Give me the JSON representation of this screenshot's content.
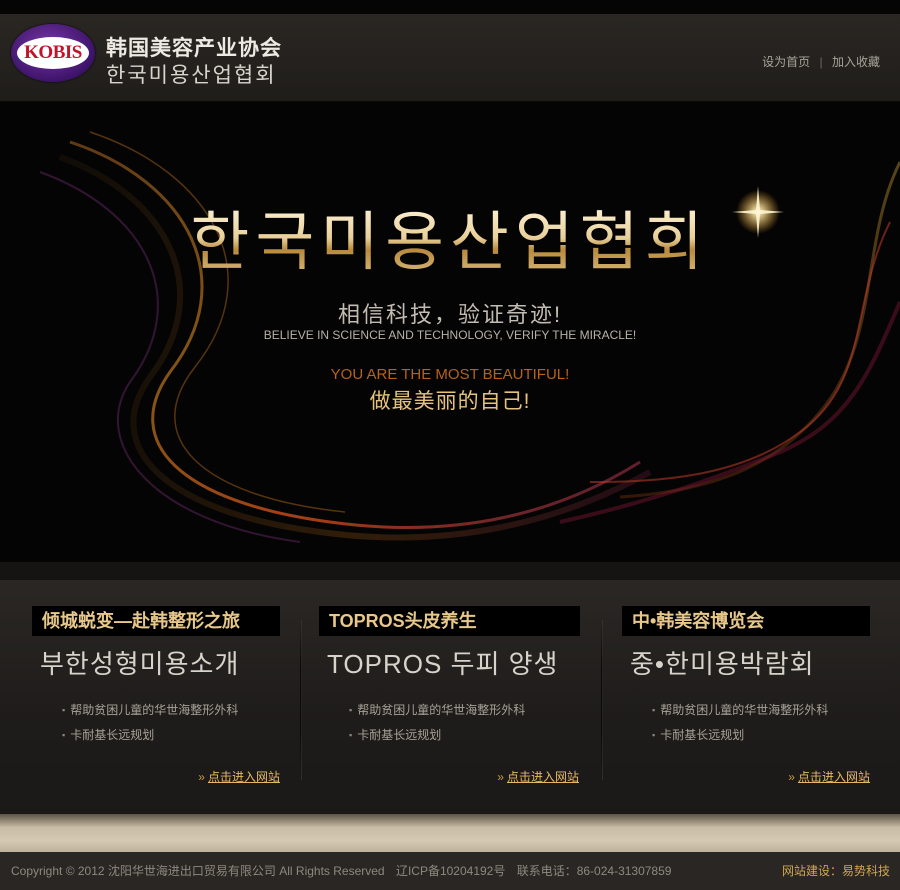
{
  "header": {
    "logo_text": "KOBIS",
    "org_name_cn": "韩国美容产业协会",
    "org_name_kr": "한국미용산업협회",
    "links": [
      "设为首页",
      "加入收藏"
    ],
    "link_separator": "|"
  },
  "hero": {
    "title_kr": "한국미용산업협회",
    "slogan_cn": "相信科技，验证奇迹!",
    "slogan_en": "BELIEVE IN SCIENCE AND TECHNOLOGY, VERIFY THE MIRACLE!",
    "tag_en": "YOU ARE THE MOST BEAUTIFUL!",
    "tag_cn": "做最美丽的自己!"
  },
  "features": [
    {
      "title": "倾城蜕变—赴韩整形之旅",
      "subtitle": "부한성형미용소개",
      "items": [
        "帮助贫困儿童的华世海整形外科",
        "卡耐基长远规划"
      ],
      "link_arrows": "»",
      "link_label": "点击进入网站"
    },
    {
      "title": "TOPROS头皮养生",
      "subtitle": "TOPROS 두피 양생",
      "items": [
        "帮助贫困儿童的华世海整形外科",
        "卡耐基长远规划"
      ],
      "link_arrows": "»",
      "link_label": "点击进入网站"
    },
    {
      "title": "中•韩美容博览会",
      "subtitle": "중•한미용박람회",
      "items": [
        "帮助贫困儿童的华世海整形外科",
        "卡耐基长远规划"
      ],
      "link_arrows": "»",
      "link_label": "点击进入网站"
    }
  ],
  "footer": {
    "copyright": "Copyright © 2012 沈阳华世海进出口贸易有限公司  All Rights Reserved",
    "icp": "辽ICP备10204192号",
    "phone": "联系电话：86-024-31307859",
    "builder": "网站建设：易势科技"
  },
  "colors": {
    "gold": "#e8c88a",
    "link_gold": "#e3b964",
    "logo_purple": "#3d1369",
    "logo_red": "#c2132a"
  }
}
